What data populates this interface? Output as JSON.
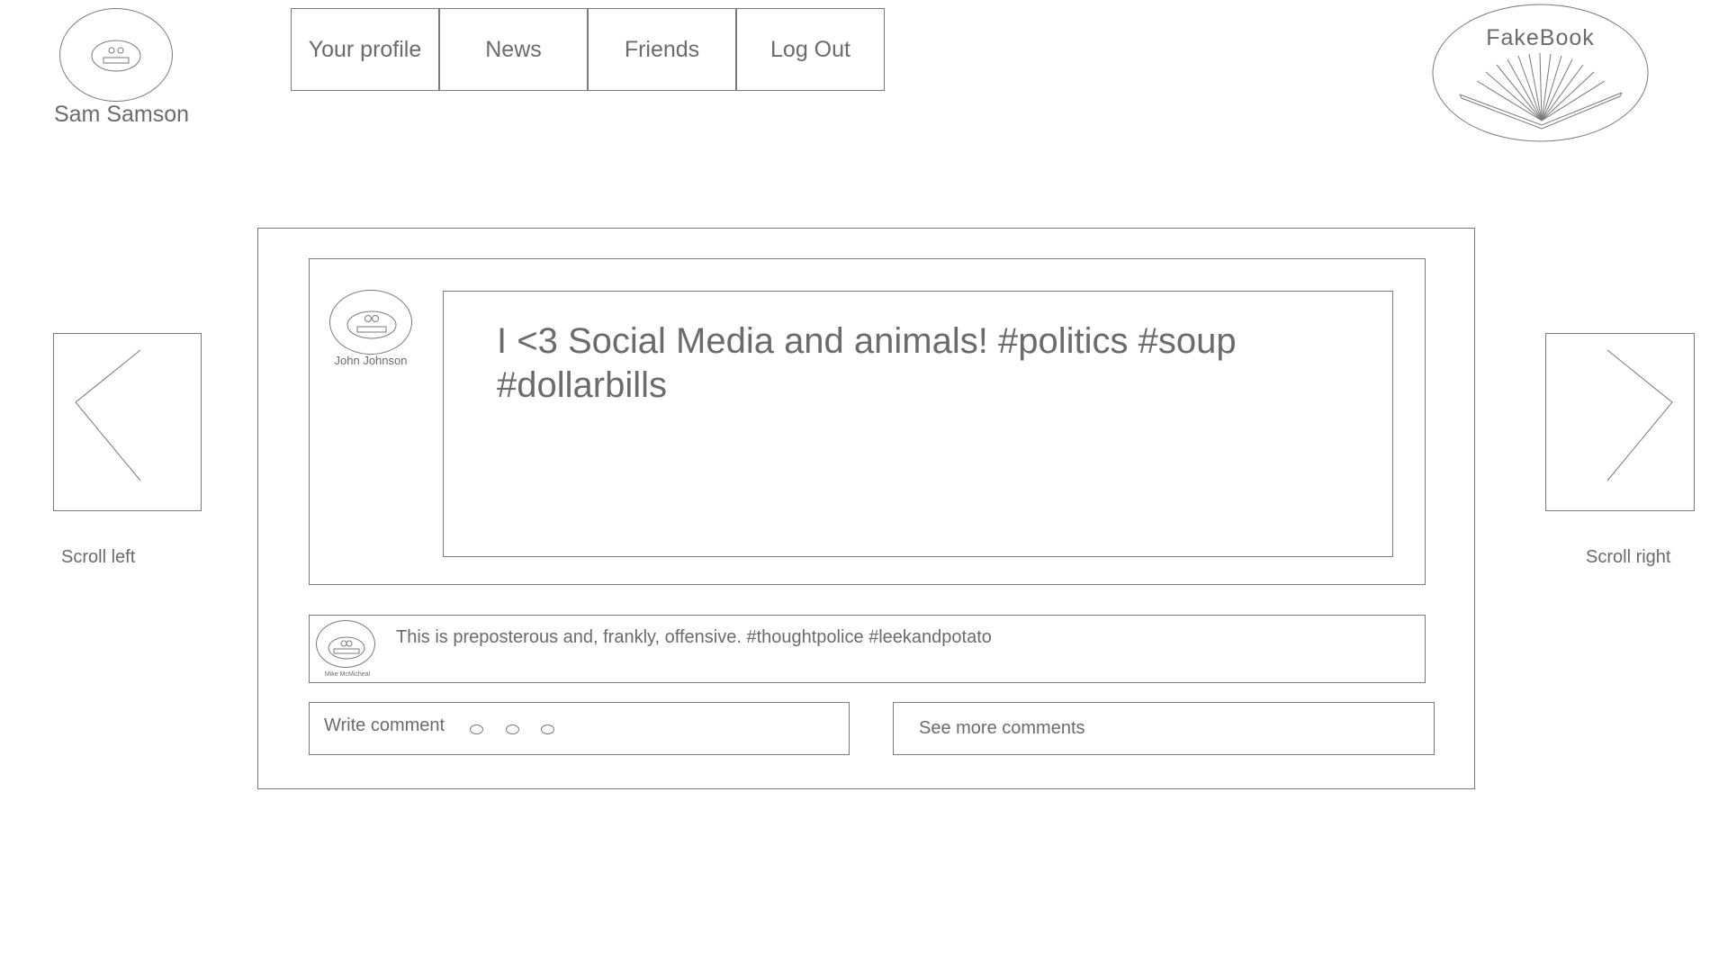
{
  "user": {
    "name": "Sam Samson",
    "avatar_icon": "robot-face-icon"
  },
  "nav": {
    "items": [
      {
        "label": "Your profile"
      },
      {
        "label": "News"
      },
      {
        "label": "Friends"
      },
      {
        "label": "Log Out"
      }
    ]
  },
  "logo": {
    "text": "FakeBook",
    "icon": "open-book-icon"
  },
  "post": {
    "author": "John Johnson",
    "text": "I <3 Social Media and animals! #politics #soup #dollarbills",
    "avatar_icon": "robot-face-icon"
  },
  "comment": {
    "author": "Mike McMicheal",
    "text": "This is preposterous and, frankly, offensive. #thoughtpolice #leekandpotato",
    "avatar_icon": "robot-face-icon"
  },
  "actions": {
    "write_comment_label": "Write comment",
    "see_more_label": "See more comments"
  },
  "scroll": {
    "left_label": "Scroll left",
    "right_label": "Scroll right"
  },
  "colors": {
    "stroke": "#7a7a7a",
    "text": "#6b6b6b",
    "background": "#ffffff"
  }
}
